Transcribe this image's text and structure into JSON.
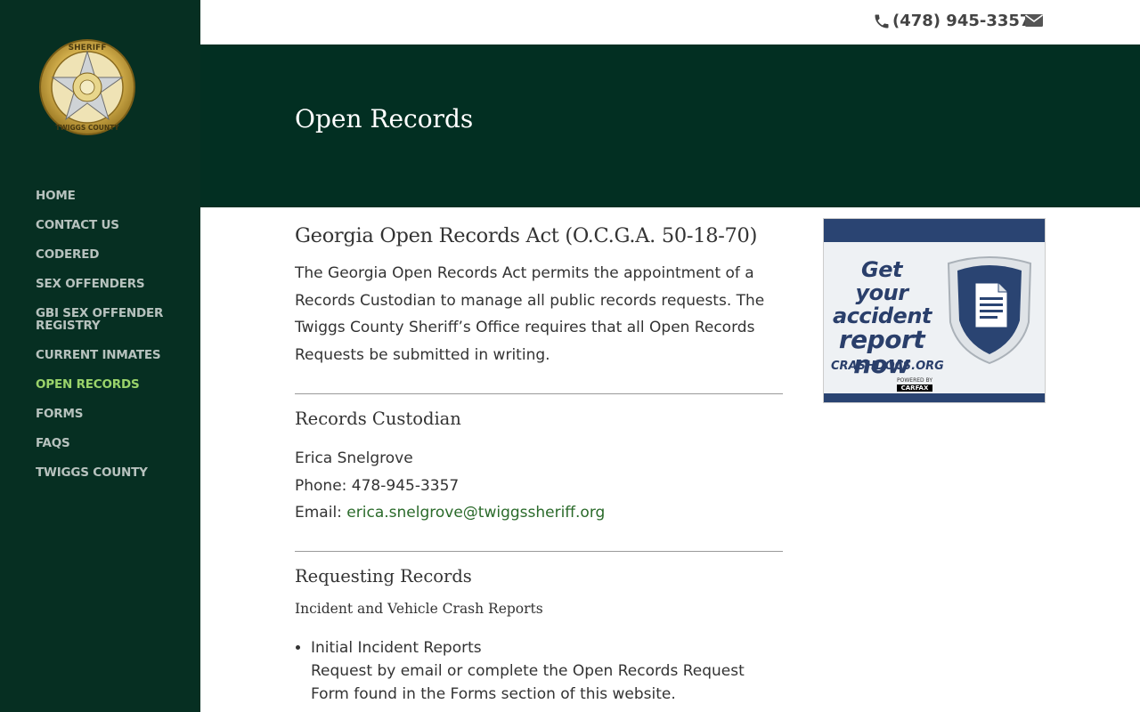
{
  "sidebar": {
    "logo_alt": "Twiggs County Sheriff's Office badge",
    "nav": [
      {
        "label": "HOME",
        "active": false
      },
      {
        "label": "CONTACT US",
        "active": false
      },
      {
        "label": "CODERED",
        "active": false
      },
      {
        "label": "SEX OFFENDERS",
        "active": false
      },
      {
        "label": "GBI SEX OFFENDER REGISTRY",
        "active": false
      },
      {
        "label": "CURRENT INMATES",
        "active": false
      },
      {
        "label": "OPEN RECORDS",
        "active": true
      },
      {
        "label": "FORMS",
        "active": false
      },
      {
        "label": "FAQS",
        "active": false
      },
      {
        "label": "TWIGGS COUNTY",
        "active": false
      }
    ]
  },
  "topbar": {
    "phone": "(478) 945-3357"
  },
  "header": {
    "title": "Open Records"
  },
  "content": {
    "heading": "Georgia Open Records Act (O.C.G.A. 50-18-70)",
    "intro": "The Georgia Open Records Act permits the appointment of a Records Custodian to manage all public records requests. The Twiggs County Sheriff’s Office requires that all Open Records Requests be submitted in writing.",
    "custodian": {
      "heading": "Records Custodian",
      "name": "Erica Snelgrove",
      "phone_label": "Phone: ",
      "phone": "478-945-3357",
      "email_label": "Email: ",
      "email": "erica.snelgrove@twiggssheriff.org"
    },
    "requesting": {
      "heading": "Requesting Records",
      "subheading": "Incident and Vehicle Crash Reports",
      "items": [
        {
          "title": "Initial Incident Reports",
          "detail": "Request by email or complete the Open Records Request Form found in the Forms section of this website."
        }
      ]
    }
  },
  "ad": {
    "line1": "Get your",
    "line2": "accident",
    "line3": "report",
    "line4": "now",
    "site": "CRASHDOCS.ORG",
    "powered": "POWERED BY",
    "carfax": "CARFAX"
  },
  "colors": {
    "sidebar_bg": "#062f22",
    "header_bg": "#022f22",
    "nav_text": "#b7c2be",
    "nav_active": "#9ad36a",
    "link": "#2a6a2a"
  }
}
